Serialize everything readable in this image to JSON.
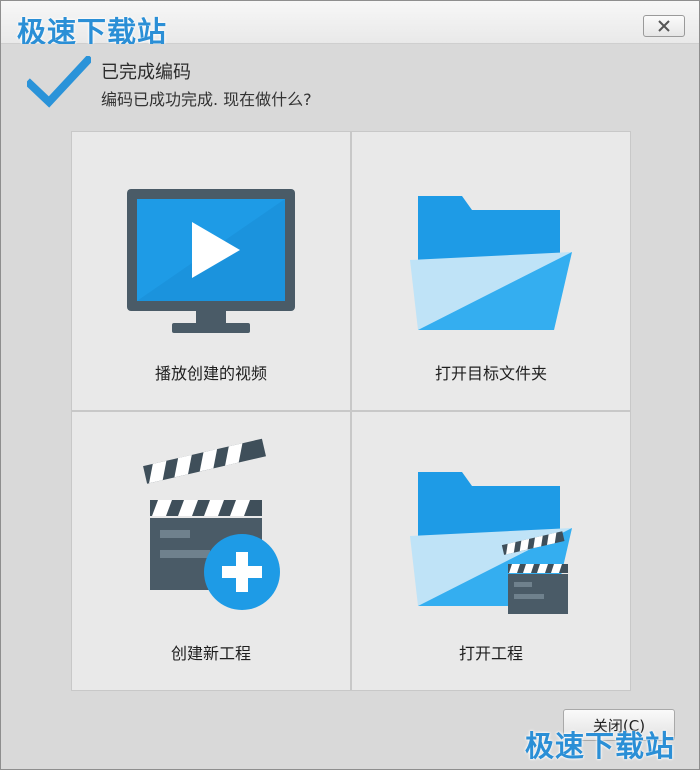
{
  "window": {
    "close_button_label": ""
  },
  "watermark": {
    "top": "极速下载站",
    "bottom": "极速下载站"
  },
  "header": {
    "title": "已完成编码",
    "subtitle": "编码已成功完成. 现在做什么?"
  },
  "actions": [
    {
      "label": "播放创建的视频",
      "icon": "monitor-play-icon"
    },
    {
      "label": "打开目标文件夹",
      "icon": "folder-open-icon"
    },
    {
      "label": "创建新工程",
      "icon": "clapperboard-add-icon"
    },
    {
      "label": "打开工程",
      "icon": "folder-clapperboard-icon"
    }
  ],
  "footer": {
    "close_label": "关闭(C)"
  },
  "colors": {
    "accent_blue": "#1e9be6",
    "light_blue": "#bfe3f7",
    "dark_slate": "#4a5b67",
    "check_blue": "#2a93d9"
  }
}
